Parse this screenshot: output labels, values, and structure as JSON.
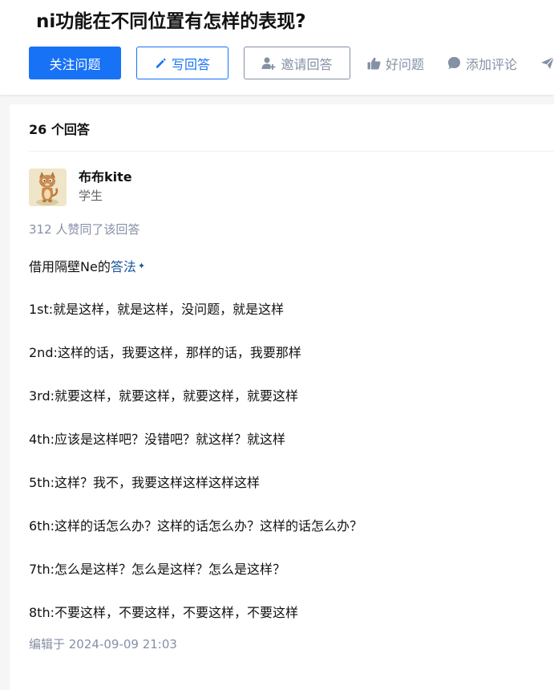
{
  "question": {
    "title": "ni功能在不同位置有怎样的表现?"
  },
  "actions": {
    "follow_label": "关注问题",
    "write_label": "写回答",
    "invite_label": "邀请回答",
    "good_question_label": "好问题",
    "comment_label": "添加评论"
  },
  "answers": {
    "count_label": "26 个回答"
  },
  "answer": {
    "author_name": "布布kite",
    "author_headline": "学生",
    "votes_text": "312 人赞同了该回答",
    "intro_prefix": "借用隔壁Ne的",
    "intro_link": "答法",
    "lines": [
      "1st:就是这样，就是这样，没问题，就是这样",
      "2nd:这样的话，我要这样，那样的话，我要那样",
      "3rd:就要这样，就要这样，就要这样，就要这样",
      "4th:应该是这样吧？没错吧？就这样？就这样",
      "5th:这样？我不，我要这样这样这样这样",
      "6th:这样的话怎么办？这样的话怎么办？这样的话怎么办？",
      "7th:怎么是这样？怎么是这样？怎么是这样？",
      "8th:不要这样，不要这样，不要这样，不要这样"
    ],
    "edited_text": "编辑于 2024-09-09 21:03"
  },
  "colors": {
    "brand_blue": "#1772f6",
    "muted_gray": "#8491a5",
    "link_blue": "#175199"
  },
  "icons": {
    "write": "pencil-icon",
    "invite": "add-user-icon",
    "good": "thumbs-up-icon",
    "comment": "comment-bubble-icon",
    "share": "paper-plane-icon",
    "link_marker": "sparkle-icon"
  }
}
